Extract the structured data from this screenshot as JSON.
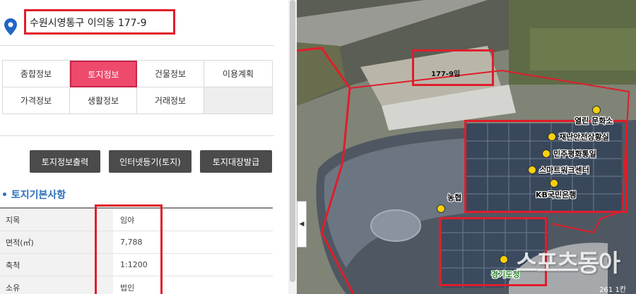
{
  "address": "수원시영통구 이의동 177-9",
  "tabs": [
    {
      "label": "종합정보",
      "active": false
    },
    {
      "label": "토지정보",
      "active": true
    },
    {
      "label": "건물정보",
      "active": false
    },
    {
      "label": "이용계획",
      "active": false
    },
    {
      "label": "가격정보",
      "active": false
    },
    {
      "label": "생활정보",
      "active": false
    },
    {
      "label": "거래정보",
      "active": false
    }
  ],
  "buttons": {
    "print": "토지정보출력",
    "registry": "인터넷등기(토지)",
    "ledger": "토지대장발급"
  },
  "section_title": "• 토지기본사항",
  "land_table": [
    {
      "label": "지목",
      "value": "임야"
    },
    {
      "label": "면적(㎡)",
      "value": "7,788"
    },
    {
      "label": "축척",
      "value": "1:1200"
    },
    {
      "label": "소유",
      "value": "법인"
    }
  ],
  "map": {
    "collapse_glyph": "◀",
    "parcel_label": "177-9임",
    "pois": [
      {
        "label": "열린 문화소"
      },
      {
        "label": "재난안전상황실"
      },
      {
        "label": "민주평화통일"
      },
      {
        "label": "스마트워크센터"
      },
      {
        "label": "KB국민은행"
      },
      {
        "label": "농협"
      },
      {
        "label": "경기도청"
      }
    ],
    "watermark": "스포츠동아",
    "scale_text": "261 1칸"
  },
  "colors": {
    "highlight": "#e01d2b",
    "active_tab": "#ee4a6c",
    "button": "#4b4b4b",
    "section_title": "#2a6fbf",
    "pin": "#1f66c6",
    "poi_icon": "#f5d20b"
  },
  "icons": {
    "pin": "location-pin-icon",
    "poi": "poi-marker-icon",
    "collapse": "chevron-left-icon"
  }
}
